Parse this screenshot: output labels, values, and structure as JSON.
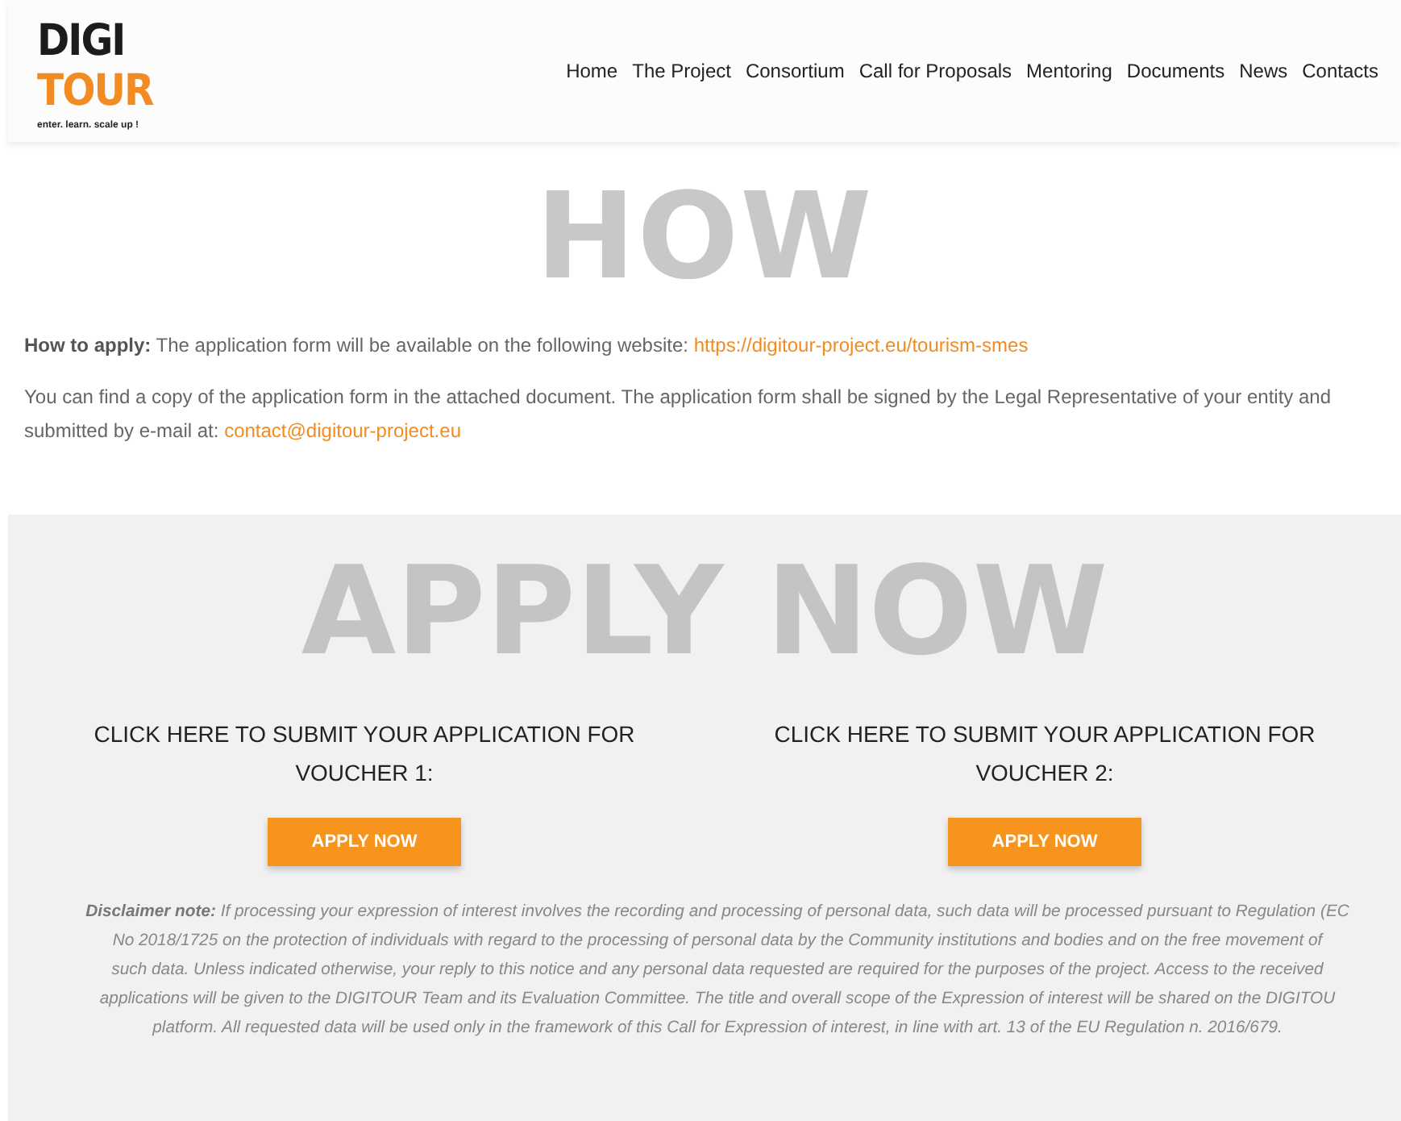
{
  "logo": {
    "line_1": "DIGI",
    "line_2": "TOUR",
    "tagline": "enter. learn. scale up !"
  },
  "nav": [
    {
      "label": "Home"
    },
    {
      "label": "The Project"
    },
    {
      "label": "Consortium"
    },
    {
      "label": "Call for Proposals"
    },
    {
      "label": "Mentoring"
    },
    {
      "label": "Documents"
    },
    {
      "label": "News"
    },
    {
      "label": "Contacts"
    }
  ],
  "how": {
    "heading": "HOW",
    "paragraphs": [
      {
        "label": "How to apply:",
        "text": "The application form will be available on the following website:",
        "link": "https://digitour-project.eu/tourism-smes"
      },
      {
        "text": "You can find a copy of the application form in the attached document. The application form shall be signed by the Legal Representative of your entity and submitted by e-mail at:",
        "link": "contact@digitour-project.eu"
      }
    ]
  },
  "apply": {
    "heading": "APPLY NOW",
    "vouchers": [
      {
        "title": "CLICK HERE TO SUBMIT YOUR APPLICATION FOR VOUCHER 1:",
        "button": "APPLY NOW"
      },
      {
        "title": "CLICK HERE TO SUBMIT YOUR APPLICATION FOR VOUCHER 2:",
        "button": "APPLY NOW"
      }
    ],
    "disclaimer": {
      "label": "Disclaimer note:",
      "lines": [
        "If processing your expression of interest involves the recording and processing of personal data, such data will be processed pursuant to Regulation (EC",
        "No 2018/1725 on the protection of individuals with regard to the processing of personal data by the Community institutions and bodies and on the free movement of",
        "such data. Unless indicated otherwise, your reply to this notice and any personal data requested are required for the purposes of the project. Access to the received",
        "applications will be given to the DIGITOUR Team and its Evaluation Committee. The title and overall scope of the Expression of interest will be shared on the DIGITOU",
        "platform. All requested data will be used only in the framework of this Call for Expression of interest, in line with art. 13 of the EU Regulation n. 2016/679."
      ]
    }
  }
}
